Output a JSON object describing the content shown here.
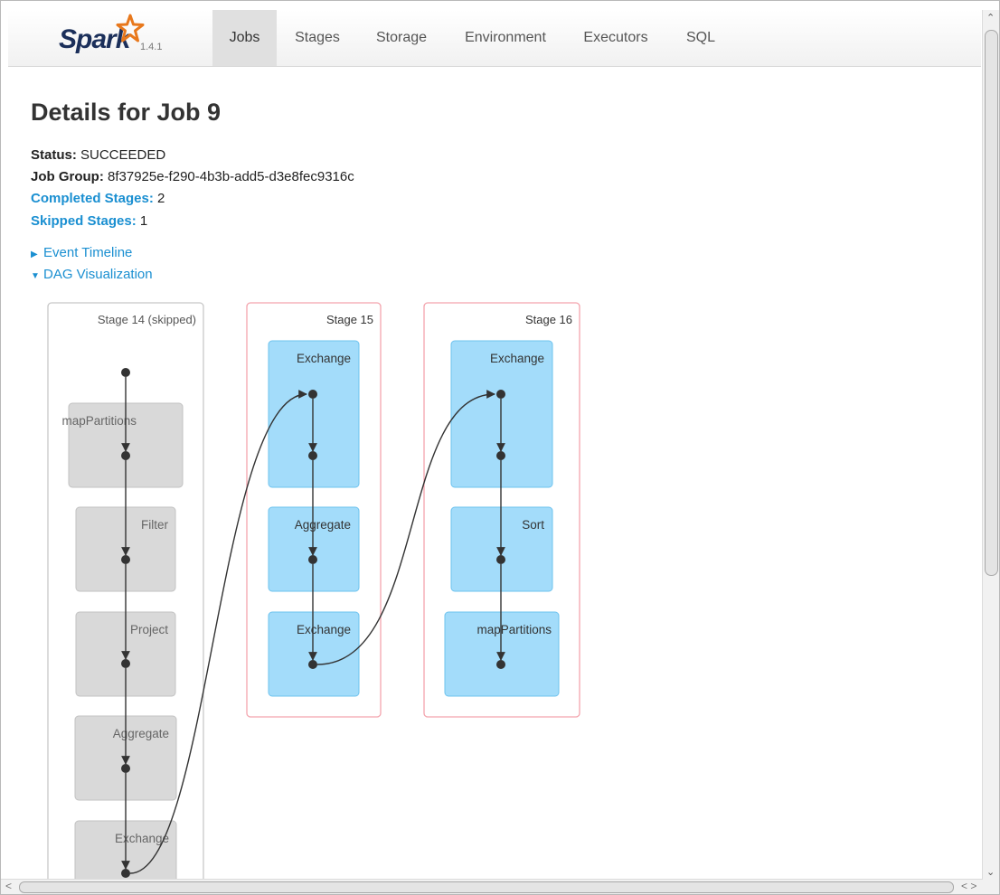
{
  "brand": {
    "name": "Spark",
    "version": "1.4.1"
  },
  "nav": {
    "tabs": [
      {
        "label": "Jobs",
        "active": true
      },
      {
        "label": "Stages",
        "active": false
      },
      {
        "label": "Storage",
        "active": false
      },
      {
        "label": "Environment",
        "active": false
      },
      {
        "label": "Executors",
        "active": false
      },
      {
        "label": "SQL",
        "active": false
      }
    ]
  },
  "page": {
    "title": "Details for Job 9",
    "status_label": "Status:",
    "status_value": "SUCCEEDED",
    "job_group_label": "Job Group:",
    "job_group_value": "8f37925e-f290-4b3b-add5-d3e8fec9316c",
    "completed_label": "Completed Stages:",
    "completed_value": "2",
    "skipped_label": "Skipped Stages:",
    "skipped_value": "1",
    "event_timeline": "Event Timeline",
    "dag_visualization": "DAG Visualization"
  },
  "dag": {
    "stages": [
      {
        "label": "Stage 14 (skipped)",
        "skipped": true,
        "nodes": [
          "mapPartitions",
          "Filter",
          "Project",
          "Aggregate",
          "Exchange"
        ]
      },
      {
        "label": "Stage 15",
        "skipped": false,
        "nodes": [
          "Exchange",
          "Aggregate",
          "Exchange"
        ]
      },
      {
        "label": "Stage 16",
        "skipped": false,
        "nodes": [
          "Exchange",
          "Sort",
          "mapPartitions"
        ]
      }
    ]
  },
  "colors": {
    "skipped_fill": "#d9d9d9",
    "skipped_border": "#c2c2c2",
    "active_fill": "#a3dcfa",
    "active_border": "#6ec3ee",
    "stage_border_active": "#f3a4ad",
    "stage_border_skipped": "#c8c8c8",
    "link": "#1a8fd1"
  }
}
